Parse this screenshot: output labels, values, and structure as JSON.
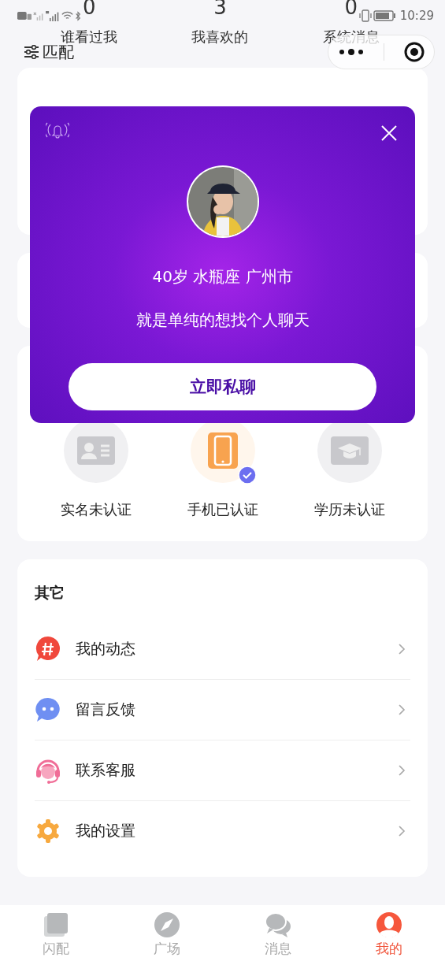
{
  "status_bar": {
    "time": "10:29"
  },
  "counters": [
    {
      "count": "0",
      "label": "谁看过我"
    },
    {
      "count": "3",
      "label": "我喜欢的"
    },
    {
      "count": "0",
      "label": "系统消息"
    }
  ],
  "filter": {
    "label": "匹配"
  },
  "verifications": [
    {
      "label": "实名未认证",
      "kind": "id",
      "verified": false
    },
    {
      "label": "手机已认证",
      "kind": "phone",
      "verified": true
    },
    {
      "label": "学历未认证",
      "kind": "education",
      "verified": false
    }
  ],
  "others": {
    "title": "其它",
    "items": [
      {
        "label": "我的动态",
        "kind": "posts"
      },
      {
        "label": "留言反馈",
        "kind": "feedback"
      },
      {
        "label": "联系客服",
        "kind": "service"
      },
      {
        "label": "我的设置",
        "kind": "settings"
      }
    ]
  },
  "tabs": [
    {
      "label": "闪配",
      "kind": "flash",
      "selected": false
    },
    {
      "label": "广场",
      "kind": "square",
      "selected": false
    },
    {
      "label": "消息",
      "kind": "messages",
      "selected": false
    },
    {
      "label": "我的",
      "kind": "me",
      "selected": true
    }
  ],
  "popup": {
    "info": "40岁 水瓶座 广州市",
    "message": "就是单纯的想找个人聊天",
    "button": "立即私聊"
  }
}
